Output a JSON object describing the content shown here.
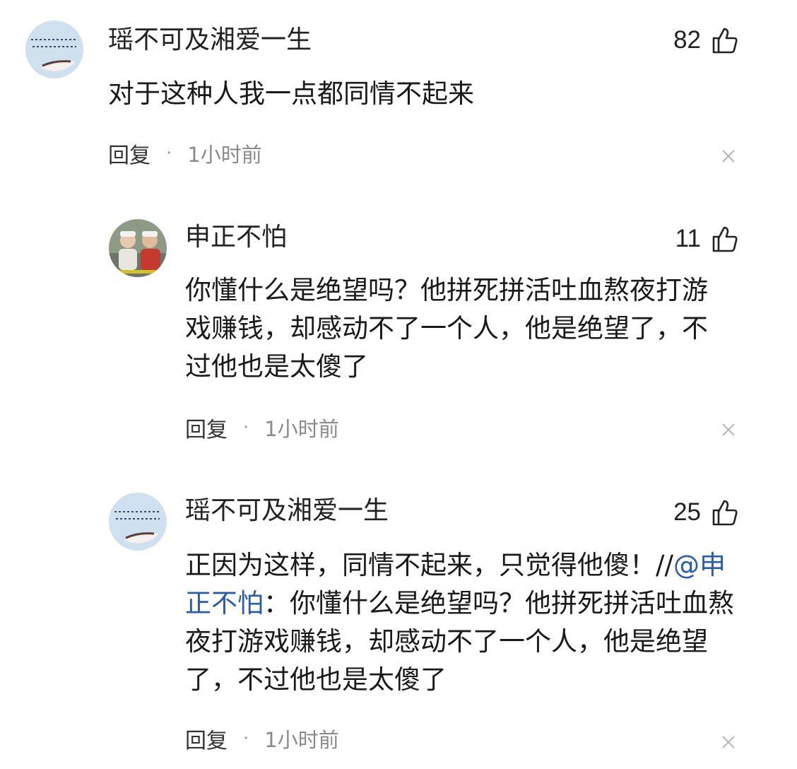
{
  "comments": [
    {
      "user": "瑶不可及湘爱一生",
      "likes": "82",
      "text": "对于这种人我一点都同情不起来",
      "reply_label": "回复",
      "separator": "·",
      "time": "1小时前",
      "avatar_icon": "avatar-calligraphy-icon"
    },
    {
      "user": "申正不怕",
      "likes": "11",
      "text": "你懂什么是绝望吗？他拼死拼活吐血熬夜打游戏赚钱，却感动不了一个人，他是绝望了，不过他也是太傻了",
      "reply_label": "回复",
      "separator": "·",
      "time": "1小时前",
      "avatar_icon": "avatar-photo-icon"
    },
    {
      "user": "瑶不可及湘爱一生",
      "likes": "25",
      "text_before": "正因为这样，同情不起来，只觉得他傻！//",
      "mention": "@申正不怕",
      "text_after": "：你懂什么是绝望吗？他拼死拼活吐血熬夜打游戏赚钱，却感动不了一个人，他是绝望了，不过他也是太傻了",
      "reply_label": "回复",
      "separator": "·",
      "time": "1小时前",
      "avatar_icon": "avatar-calligraphy-icon"
    }
  ]
}
